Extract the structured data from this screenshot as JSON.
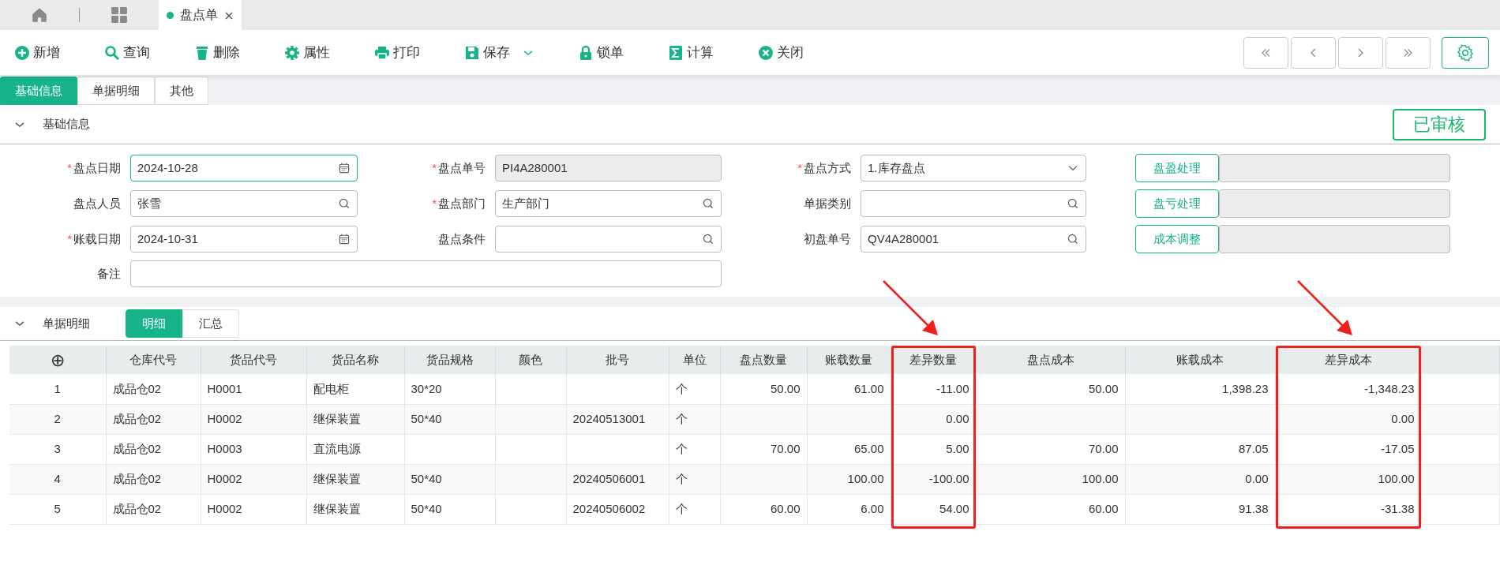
{
  "tabs": [
    {
      "kind": "home",
      "selected": false
    },
    {
      "kind": "apps",
      "selected": false
    },
    {
      "kind": "page",
      "label": "盘点单",
      "selected": true
    }
  ],
  "toolbar": [
    {
      "kind": "plus",
      "label": "新增"
    },
    {
      "kind": "search",
      "label": "查询"
    },
    {
      "kind": "trash",
      "label": "删除"
    },
    {
      "kind": "gear",
      "label": "属性"
    },
    {
      "kind": "print",
      "label": "打印"
    },
    {
      "kind": "save",
      "label": "保存",
      "dropdown": true
    },
    {
      "kind": "lock",
      "label": "锁单"
    },
    {
      "kind": "sigma",
      "label": "计算"
    },
    {
      "kind": "close",
      "label": "关闭"
    }
  ],
  "pager": [
    {
      "kind": "first"
    },
    {
      "kind": "prev"
    },
    {
      "kind": "next"
    },
    {
      "kind": "last"
    }
  ],
  "form_tabs": [
    {
      "label": "基础信息",
      "selected": true
    },
    {
      "label": "单据明细",
      "selected": false
    },
    {
      "label": "其他",
      "selected": false
    }
  ],
  "basic_section": {
    "title": "基础信息",
    "expanded": true,
    "status_stamp": "已审核",
    "fields": [
      {
        "required_mark": "*",
        "label": "盘点日期",
        "value": "2024-10-28",
        "kind": "date",
        "focused": true
      },
      {
        "required_mark": "*",
        "label": "盘点单号",
        "value": "PI4A280001",
        "kind": "readonly",
        "focused": false
      },
      {
        "required_mark": "*",
        "label": "盘点方式",
        "value": "1.库存盘点",
        "kind": "select",
        "focused": false
      },
      {
        "label": "盘点人员",
        "value": "张雪",
        "kind": "lookup",
        "focused": false
      },
      {
        "required_mark": "*",
        "label": "盘点部门",
        "value": "生产部门",
        "kind": "lookup",
        "focused": false
      },
      {
        "label": "单据类别",
        "kind": "lookup",
        "focused": false
      },
      {
        "required_mark": "*",
        "label": "账载日期",
        "value": "2024-10-31",
        "kind": "date",
        "focused": false
      },
      {
        "label": "盘点条件",
        "kind": "lookup",
        "focused": false
      },
      {
        "label": "初盘单号",
        "value": "QV4A280001",
        "kind": "lookup",
        "focused": false
      },
      {
        "label": "备注",
        "kind": "text",
        "focused": false
      }
    ],
    "actions": [
      {
        "label": "盘盈处理"
      },
      {
        "label": "盘亏处理"
      },
      {
        "label": "成本调整"
      }
    ]
  },
  "detail_section": {
    "title": "单据明细",
    "expanded": true,
    "views": [
      {
        "label": "明细",
        "selected": true
      },
      {
        "label": "汇总",
        "selected": false
      }
    ],
    "table": {
      "columns": [
        {
          "label": "⊕",
          "highlighted": false
        },
        {
          "label": "仓库代号",
          "highlighted": false
        },
        {
          "label": "货品代号",
          "highlighted": false
        },
        {
          "label": "货品名称",
          "highlighted": false
        },
        {
          "label": "货品规格",
          "highlighted": false
        },
        {
          "label": "颜色",
          "highlighted": false
        },
        {
          "label": "批号",
          "highlighted": false
        },
        {
          "label": "单位",
          "highlighted": false
        },
        {
          "label": "盘点数量",
          "highlighted": false
        },
        {
          "label": "账载数量",
          "highlighted": false
        },
        {
          "label": "差异数量",
          "highlighted": true
        },
        {
          "label": "盘点成本",
          "highlighted": false
        },
        {
          "label": "账载成本",
          "highlighted": false
        },
        {
          "label": "差异成本",
          "highlighted": true
        }
      ],
      "rows": [
        [
          "1",
          "成品仓02",
          "H0001",
          "配电柜",
          "30*20",
          null,
          null,
          "个",
          "50.00",
          "61.00",
          "-11.00",
          "50.00",
          "1,398.23",
          "-1,348.23"
        ],
        [
          "2",
          "成品仓02",
          "H0002",
          "继保装置",
          "50*40",
          null,
          "20240513001",
          "个",
          null,
          null,
          "0.00",
          null,
          null,
          "0.00"
        ],
        [
          "3",
          "成品仓02",
          "H0003",
          "直流电源",
          null,
          null,
          null,
          "个",
          "70.00",
          "65.00",
          "5.00",
          "70.00",
          "87.05",
          "-17.05"
        ],
        [
          "4",
          "成品仓02",
          "H0002",
          "继保装置",
          "50*40",
          null,
          "20240506001",
          "个",
          null,
          "100.00",
          "-100.00",
          "100.00",
          "0.00",
          "100.00"
        ],
        [
          "5",
          "成品仓02",
          "H0002",
          "继保装置",
          "50*40",
          null,
          "20240506002",
          "个",
          "60.00",
          "6.00",
          "54.00",
          "60.00",
          "91.38",
          "-31.38"
        ]
      ]
    }
  }
}
